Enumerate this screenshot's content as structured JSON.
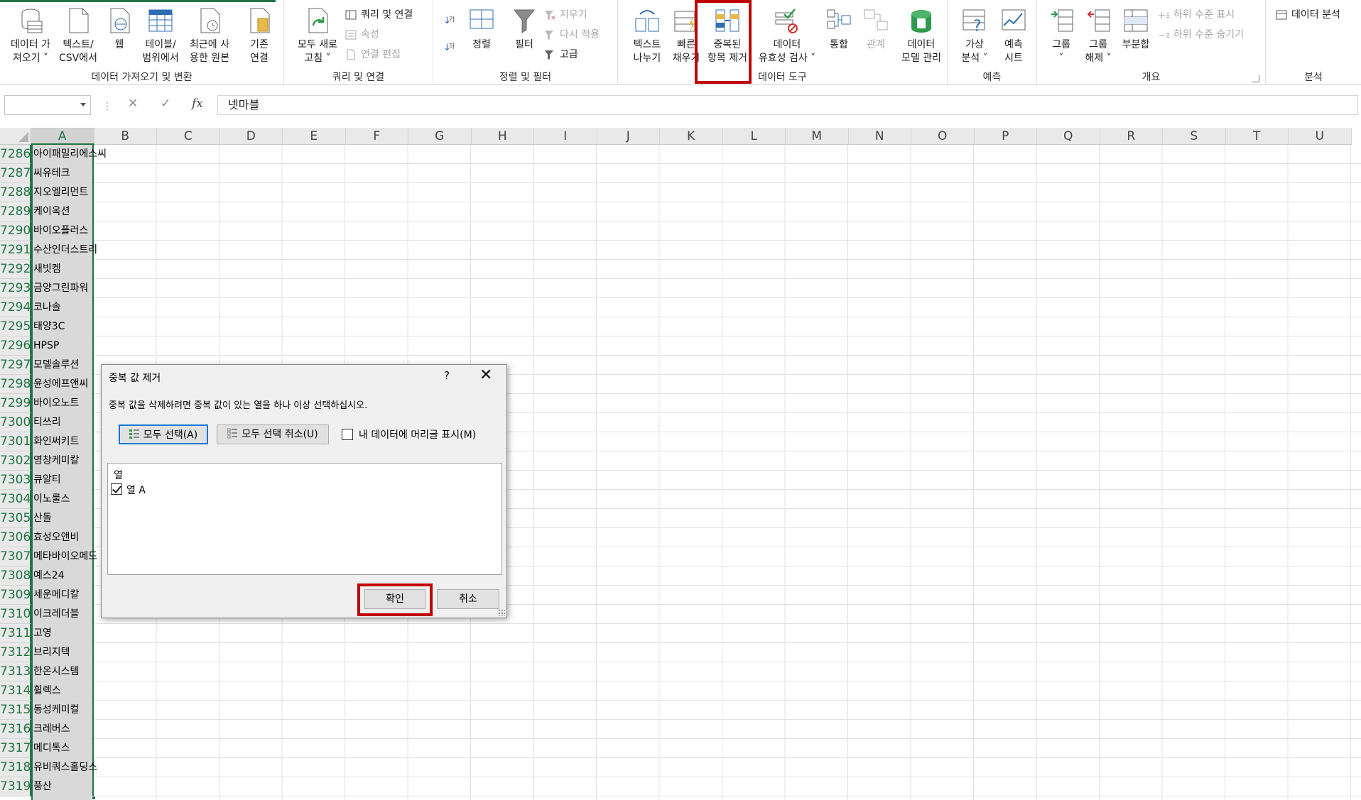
{
  "ribbon": {
    "groups": {
      "get_transform": "데이터 가져오기 및 변환",
      "queries": "쿼리 및 연결",
      "sort_filter": "정렬 및 필터",
      "data_tools": "데이터 도구",
      "forecast": "예측",
      "outline": "개요",
      "analysis": "분석"
    },
    "buttons": {
      "get_data": [
        "데이터 가",
        "져오기 ˅"
      ],
      "from_text": [
        "텍스트/",
        "CSV에서"
      ],
      "web": [
        "웹"
      ],
      "from_table": [
        "테이블/",
        "범위에서"
      ],
      "recent": [
        "최근에 사",
        "용한 원본"
      ],
      "existing": [
        "기존",
        "연결"
      ],
      "refresh_all": [
        "모두 새로",
        "고침 ˅"
      ],
      "queries_conn": "쿼리 및 연결",
      "properties": "속성",
      "edit_links": "연결 편집",
      "sort": "정렬",
      "filter": "필터",
      "clear": "지우기",
      "reapply": "다시 적용",
      "advanced": "고급",
      "text_to_cols": [
        "텍스트",
        "나누기"
      ],
      "flash_fill": [
        "빠른",
        "채우기"
      ],
      "remove_dup": [
        "중복된",
        "항목 제거"
      ],
      "validation": [
        "데이터",
        "유효성 검사 ˅"
      ],
      "consolidate": [
        "통합"
      ],
      "relations": [
        "관계"
      ],
      "data_model": [
        "데이터",
        "모델 관리"
      ],
      "whatif": [
        "가상",
        "분석 ˅"
      ],
      "forecast_sheet": [
        "예측",
        "시트"
      ],
      "group": [
        "그룹",
        "˅"
      ],
      "ungroup": [
        "그룹",
        "해제 ˅"
      ],
      "subtotal": [
        "부분합"
      ],
      "show_detail": "하위 수준 표시",
      "hide_detail": "하위 수준 숨기기",
      "data_analysis": "데이터 분석"
    }
  },
  "formula_bar": {
    "name_box": "",
    "fx": "fx",
    "value": "넷마블"
  },
  "columns": [
    "A",
    "B",
    "C",
    "D",
    "E",
    "F",
    "G",
    "H",
    "I",
    "J",
    "K",
    "L",
    "M",
    "N",
    "O",
    "P",
    "Q",
    "R",
    "S",
    "T",
    "U"
  ],
  "rows": [
    {
      "n": "7286",
      "a": "아이패밀리에스씨"
    },
    {
      "n": "7287",
      "a": "씨유테크"
    },
    {
      "n": "7288",
      "a": "지오엘리먼트"
    },
    {
      "n": "7289",
      "a": "케이옥션"
    },
    {
      "n": "7290",
      "a": "바이오플러스"
    },
    {
      "n": "7291",
      "a": "수산인더스트리"
    },
    {
      "n": "7292",
      "a": "새빗켐"
    },
    {
      "n": "7293",
      "a": "금양그린파워"
    },
    {
      "n": "7294",
      "a": "코나솔"
    },
    {
      "n": "7295",
      "a": "태양3C"
    },
    {
      "n": "7296",
      "a": "HPSP"
    },
    {
      "n": "7297",
      "a": "모델솔루션"
    },
    {
      "n": "7298",
      "a": "윤성에프앤씨"
    },
    {
      "n": "7299",
      "a": "바이오노트"
    },
    {
      "n": "7300",
      "a": "티쓰리"
    },
    {
      "n": "7301",
      "a": "화인써키트"
    },
    {
      "n": "7302",
      "a": "영창케미칼"
    },
    {
      "n": "7303",
      "a": "큐알티"
    },
    {
      "n": "7304",
      "a": "이노룰스"
    },
    {
      "n": "7305",
      "a": "산돌"
    },
    {
      "n": "7306",
      "a": "효성오앤비"
    },
    {
      "n": "7307",
      "a": "메타바이오메드"
    },
    {
      "n": "7308",
      "a": "예스24"
    },
    {
      "n": "7309",
      "a": "세운메디칼"
    },
    {
      "n": "7310",
      "a": "이크레더블"
    },
    {
      "n": "7311",
      "a": "고영"
    },
    {
      "n": "7312",
      "a": "브리지텍"
    },
    {
      "n": "7313",
      "a": "한온시스템"
    },
    {
      "n": "7314",
      "a": "휠렉스"
    },
    {
      "n": "7315",
      "a": "동성케미컬"
    },
    {
      "n": "7316",
      "a": "크레버스"
    },
    {
      "n": "7317",
      "a": "메디톡스"
    },
    {
      "n": "7318",
      "a": "유비쿼스홀딩스"
    },
    {
      "n": "7319",
      "a": "풍산"
    }
  ],
  "dialog": {
    "title": "중복 값 제거",
    "help": "?",
    "close": "✕",
    "message": "중복 값을 삭제하려면 중복 값이 있는 열을 하나 이상 선택하십시오.",
    "select_all": "모두 선택(A)",
    "unselect_all": "모두 선택 취소(U)",
    "headers_label": "내 데이터에 머리글 표시(M)",
    "headers_checked": false,
    "list_header": "열",
    "columns": [
      {
        "label": "열 A",
        "checked": true
      }
    ],
    "ok": "확인",
    "cancel": "취소"
  },
  "colors": {
    "excel_green": "#217346",
    "highlight_red": "#c00000",
    "focus_blue": "#0078d7"
  }
}
